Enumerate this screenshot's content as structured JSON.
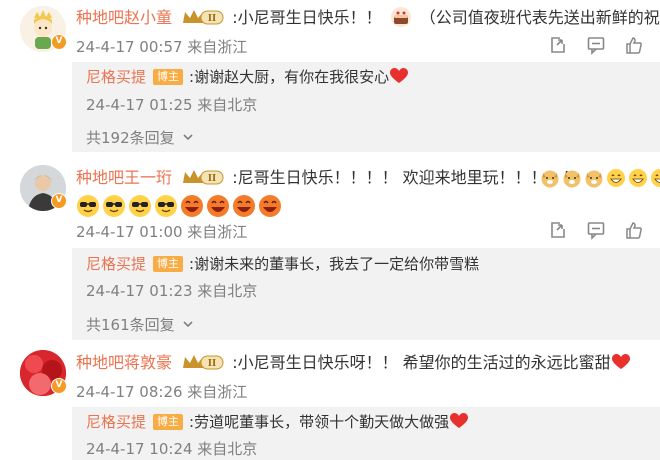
{
  "comments": [
    {
      "username": "种地吧赵小童",
      "level": "II",
      "text_before": ":小尼哥生日快乐！！",
      "text_after": "（公司值夜班代表先送出新鲜的祝福",
      "time": "24-4-17 00:57 来自浙江",
      "reply": {
        "username": "尼格买提",
        "badge": "博主",
        "text": ":谢谢赵大厨，有你在我很安心",
        "time": "24-4-17 01:25 来自北京"
      },
      "more_replies": "共192条回复"
    },
    {
      "username": "种地吧王一珩",
      "level": "II",
      "text": ":尼哥生日快乐！！！！ 欢迎来地里玩！！！！！",
      "time": "24-4-17 01:00 来自浙江",
      "reply": {
        "username": "尼格买提",
        "badge": "博主",
        "text": ":谢谢未来的董事长，我去了一定给你带雪糕",
        "time": "24-4-17 01:23 来自北京"
      },
      "more_replies": "共161条回复"
    },
    {
      "username": "种地吧蒋敦豪",
      "level": "II",
      "text": ":小尼哥生日快乐呀！！ 希望你的生活过的永远比蜜甜",
      "time": "24-4-17 08:26 来自浙江",
      "reply": {
        "username": "尼格买提",
        "badge": "博主",
        "text": ":劳道呢董事长，带领十个勤天做大做强",
        "time": "24-4-17 10:24 来自北京"
      }
    }
  ],
  "icons": {
    "verified": "V",
    "actions": [
      "share-icon",
      "comment-icon",
      "like-icon"
    ]
  },
  "colors": {
    "username": "#eb7350",
    "meta": "#808080",
    "reply_bg": "#f2f2f2",
    "badge": "#f7ad44",
    "heart": "#e8302c"
  }
}
